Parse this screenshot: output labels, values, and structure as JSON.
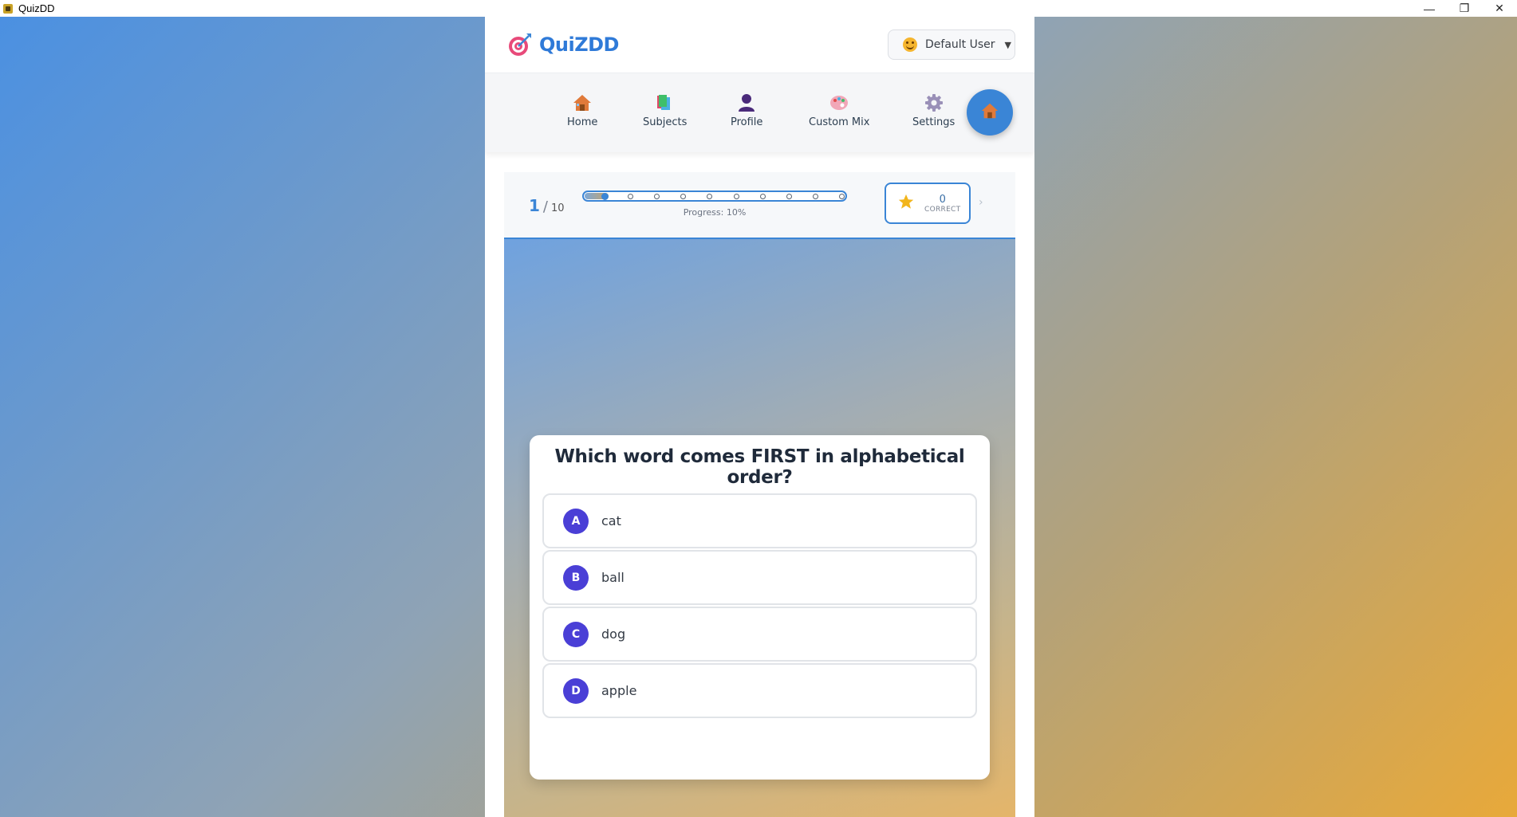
{
  "window": {
    "title": "QuizDD",
    "controls": [
      "—",
      "❐",
      "✕"
    ]
  },
  "brand": {
    "name": "QuiZDD"
  },
  "user": {
    "name": "Default User",
    "caret": "▼"
  },
  "nav": {
    "items": [
      {
        "label": "Home",
        "icon": "house-icon"
      },
      {
        "label": "Subjects",
        "icon": "books-icon"
      },
      {
        "label": "Profile",
        "icon": "person-icon"
      },
      {
        "label": "Custom Mix",
        "icon": "palette-icon"
      },
      {
        "label": "Settings",
        "icon": "gear-icon"
      }
    ],
    "fab_icon": "house-icon"
  },
  "progress": {
    "current": "1",
    "separator": "/",
    "total": "10",
    "label": "Progress: 10%",
    "fraction": 0.1,
    "steps": 10,
    "active_step": 1
  },
  "score": {
    "value": "0",
    "label": "CORRECT",
    "chevron": "›"
  },
  "quiz": {
    "question": "Which word comes FIRST in alphabetical order?",
    "options": [
      {
        "letter": "A",
        "text": "cat"
      },
      {
        "letter": "B",
        "text": "ball"
      },
      {
        "letter": "C",
        "text": "dog"
      },
      {
        "letter": "D",
        "text": "apple"
      }
    ]
  },
  "colors": {
    "accent": "#3a85d6",
    "brand": "#2f7ad8",
    "badge": "#4a3fd6",
    "star": "#f2b51c"
  }
}
